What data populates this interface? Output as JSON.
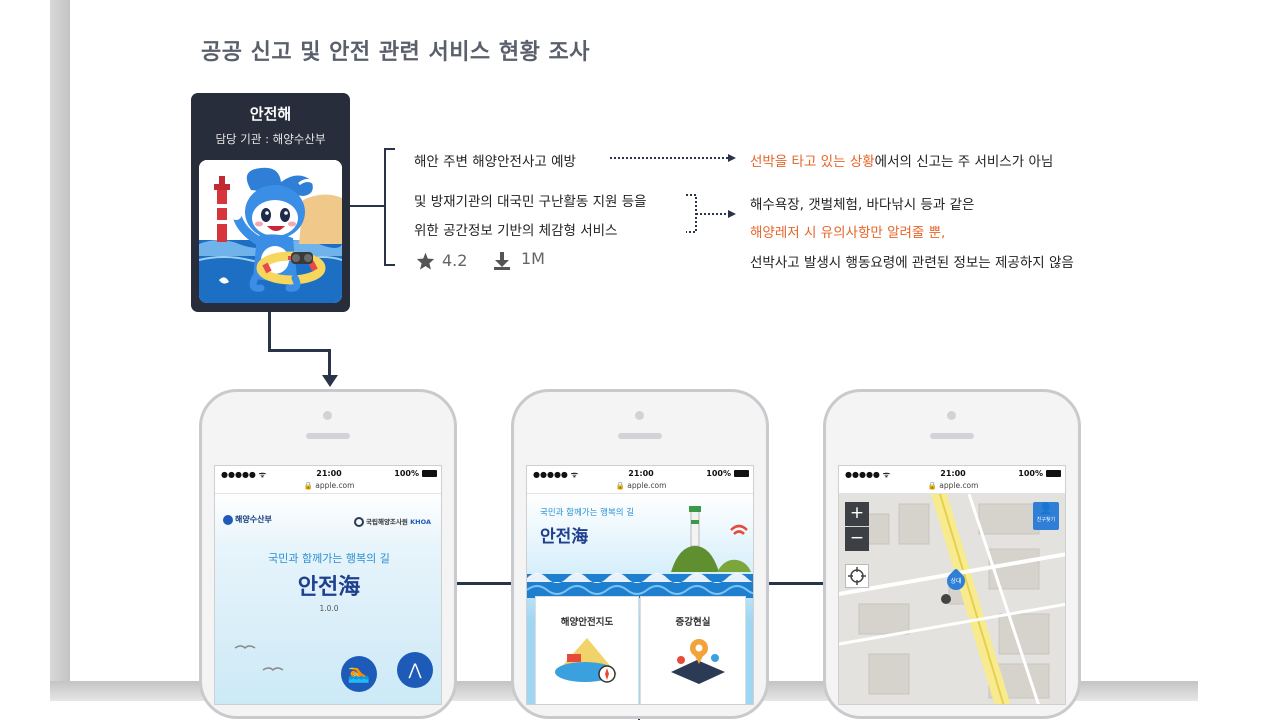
{
  "page": {
    "title": "공공 신고 및 안전 관련 서비스 현황 조사"
  },
  "app": {
    "name": "안전해",
    "agency": "담당 기관 : 해양수산부",
    "features": [
      "해안 주변 해양안전사고 예방",
      "및 방재기관의 대국민 구난활동 지원 등을",
      "위한 공간정보 기반의 체감형 서비스"
    ],
    "rating": "4.2",
    "downloads": "1M",
    "icons": {
      "rating": "star-icon",
      "downloads": "download-icon"
    }
  },
  "notes": {
    "note1_highlight": "선박을 타고 있는 상황",
    "note1_rest": "에서의 신고는 주 서비스가 아님",
    "note2_line1": "해수욕장, 갯벌체험, 바다낚시 등과 같은",
    "note2_line2": "해양레저 시 유의사항만  알려줄 뿐,",
    "note2_line3": "선박사고 발생시 행동요령에 관련된 정보는 제공하지 않음"
  },
  "phones": {
    "status_dots": "●●●●● ᯤ",
    "status_time": "21:00",
    "status_battery": "100%",
    "url": "🔒 apple.com",
    "phone1": {
      "logo_left": "해양수산부",
      "logo_right": "국립해양조사원",
      "logo_right_en": "KHOA",
      "slogan": "국민과 함께가는 행복의 길",
      "title": "안전海",
      "version": "1.0.0"
    },
    "phone2": {
      "slogan": "국민과 함께가는 행복의 길",
      "title": "안전海",
      "menu_left": "해양안전지도",
      "menu_right": "증강현실"
    },
    "phone3": {
      "zoom_in": "+",
      "zoom_out": "−",
      "location_btn": "친구찾기",
      "marker_label": "상대"
    }
  },
  "colors": {
    "accent": "#e8652a",
    "card_bg": "#272d3a",
    "connector": "#2a3449",
    "title": "#5a5f6c"
  }
}
